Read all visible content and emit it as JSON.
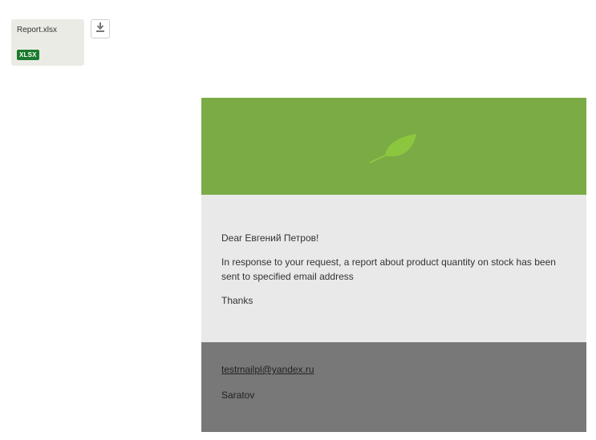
{
  "attachment": {
    "filename": "Report.xlsx",
    "badge": "XLSX",
    "badge_color": "#1b7a2d",
    "download_icon": "download-icon"
  },
  "email": {
    "header_color": "#7aab45",
    "logo_icon": "leaf-icon",
    "greeting": "Dear Евгений Петров!",
    "message": "In response to your request, a report about product quantity on stock has been sent to specified email address",
    "closing": "Thanks",
    "footer": {
      "email": "testmailpl@yandex.ru",
      "city": "Saratov"
    },
    "footer_color": "#787878",
    "content_bg_color": "#e9e9e9"
  }
}
